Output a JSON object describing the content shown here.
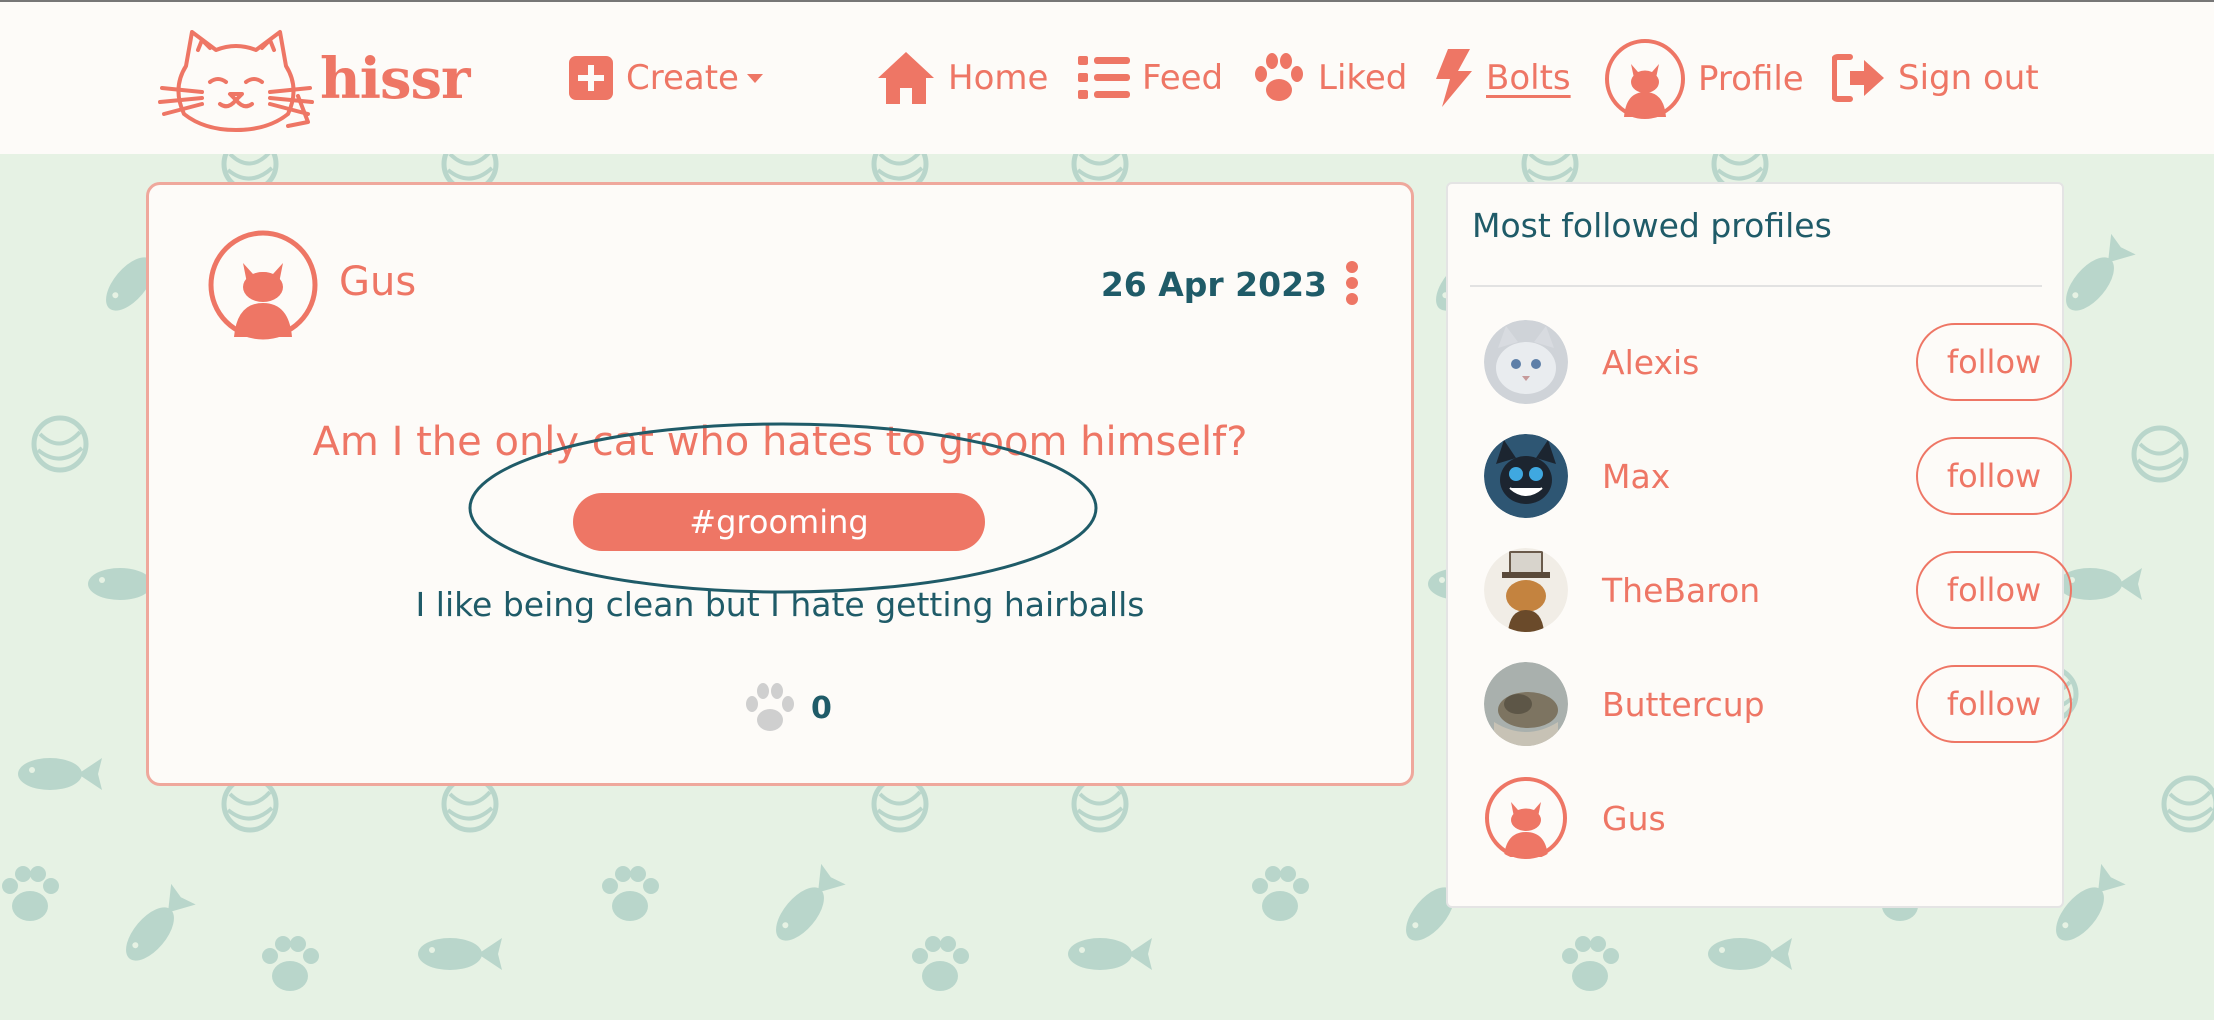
{
  "brand": {
    "name": "hissr"
  },
  "nav": {
    "create": "Create",
    "home": "Home",
    "feed": "Feed",
    "liked": "Liked",
    "bolts": "Bolts",
    "profile": "Profile",
    "signout": "Sign out"
  },
  "post": {
    "author": "Gus",
    "date": "26 Apr 2023",
    "title": "Am I the only cat who hates to groom himself?",
    "tag": "#grooming",
    "body": "I like being clean but I hate getting hairballs",
    "likes": "0"
  },
  "sidebar": {
    "title": "Most followed profiles",
    "profiles": [
      {
        "name": "Alexis",
        "follow": "follow"
      },
      {
        "name": "Max",
        "follow": "follow"
      },
      {
        "name": "TheBaron",
        "follow": "follow"
      },
      {
        "name": "Buttercup",
        "follow": "follow"
      },
      {
        "name": "Gus"
      }
    ]
  },
  "colors": {
    "accent": "#ee7665",
    "text_dark": "#1f5b68",
    "background": "#e6f2e4",
    "pattern": "#b9d6cb",
    "card": "#fdfbf8"
  },
  "icons": [
    "cat-logo-icon",
    "plus-square-icon",
    "home-icon",
    "list-icon",
    "paw-icon",
    "bolt-icon",
    "cat-avatar-icon",
    "sign-out-icon"
  ]
}
